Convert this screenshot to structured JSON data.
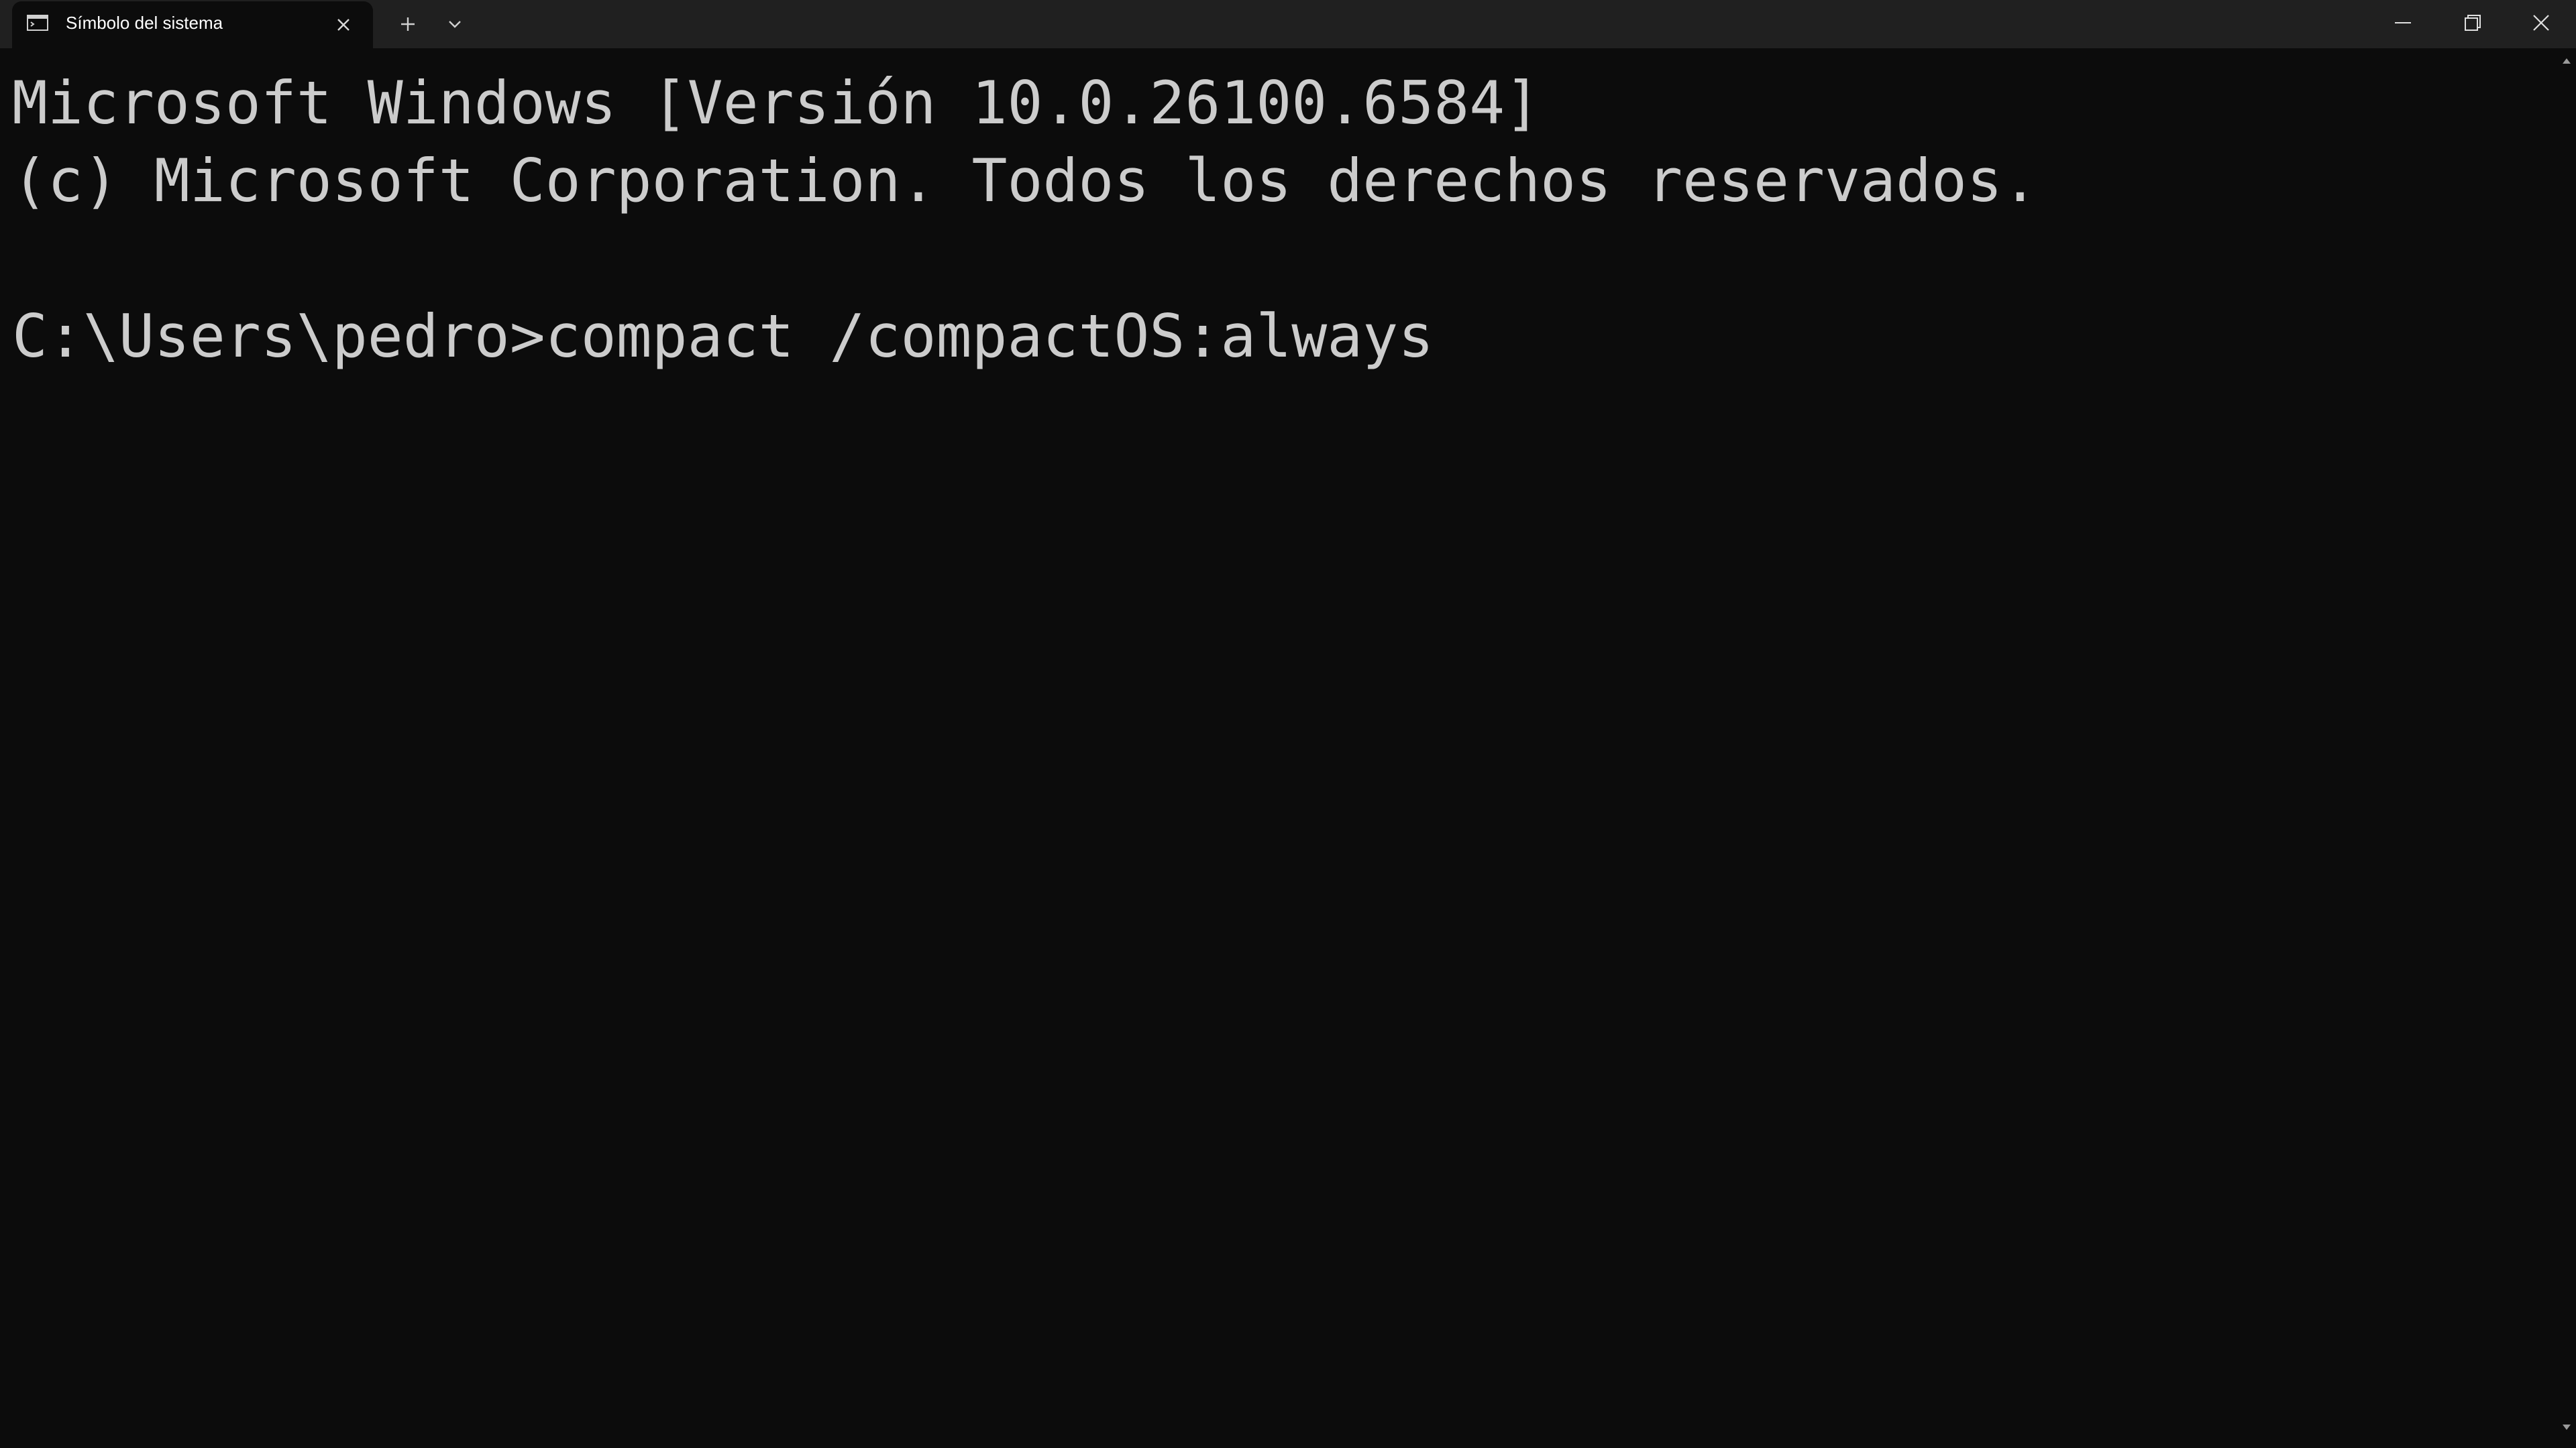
{
  "tab": {
    "title": "Símbolo del sistema",
    "icon": "terminal-icon"
  },
  "titlebar": {
    "new_tab_icon": "plus-icon",
    "dropdown_icon": "chevron-down-icon",
    "minimize_icon": "minimize-icon",
    "maximize_icon": "restore-icon",
    "close_icon": "close-icon"
  },
  "terminal": {
    "lines": [
      "Microsoft Windows [Versión 10.0.26100.6584]",
      "(c) Microsoft Corporation. Todos los derechos reservados.",
      "C:\\Users\\pedro>compact /compactOS:always"
    ]
  },
  "colors": {
    "background": "#0c0c0c",
    "titlebar": "#202020",
    "text": "#cccccc"
  }
}
